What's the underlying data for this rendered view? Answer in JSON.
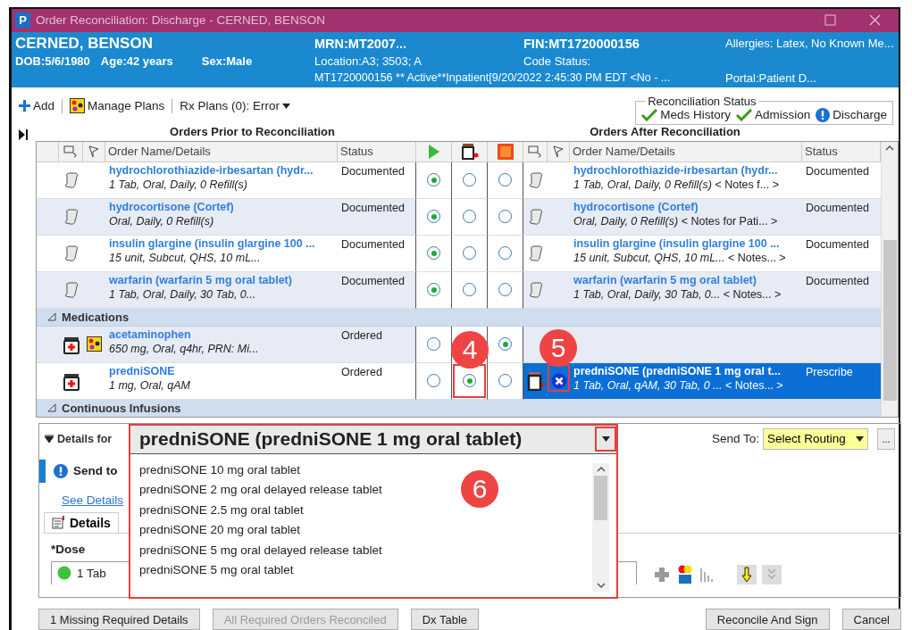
{
  "window": {
    "title": "Order Reconciliation: Discharge - CERNED, BENSON",
    "app_letter": "P"
  },
  "patient": {
    "name": "CERNED, BENSON",
    "dob": "DOB:5/6/1980",
    "age": "Age:42 years",
    "sex": "Sex:Male",
    "mrn": "MRN:MT2007...",
    "location": "Location:A3; 3503; A",
    "encounter": "MT1720000156 ** Active**Inpatient[9/20/2022 2:45:30 PM EDT <No - ...",
    "fin": "FIN:MT1720000156",
    "code_status": "Code Status:",
    "allergies": "Allergies: Latex, No Known Me...",
    "portal": "Portal:Patient D..."
  },
  "toolbar": [
    {
      "kind": "add",
      "label": "Add"
    },
    {
      "kind": "plans",
      "label": "Manage Plans"
    },
    {
      "kind": "menu",
      "label": "Rx Plans (0): Error"
    }
  ],
  "reconciliation_status": {
    "title": "Reconciliation Status",
    "items": [
      {
        "label": "Meds History",
        "complete": true
      },
      {
        "label": "Admission",
        "complete": true
      },
      {
        "label": "Discharge",
        "complete": false
      }
    ]
  },
  "prior": {
    "title": "Orders Prior to Reconciliation",
    "columns": [
      "Order Name/Details",
      "Status"
    ]
  },
  "after": {
    "title": "Orders After Reconciliation",
    "columns": [
      "Order Name/Details",
      "Status"
    ]
  },
  "rows": [
    {
      "kind": "order",
      "prior": {
        "kind": "home",
        "name": "hydrochlorothiazide-irbesartan (hydr...",
        "details": "1 Tab, Oral, Daily, 0 Refill(s)",
        "status": "Documented"
      },
      "choices": [
        {
          "kind": "continue",
          "selected": true
        },
        {
          "kind": "modify",
          "selected": false
        },
        {
          "kind": "stop",
          "selected": false
        }
      ],
      "after": {
        "kind": "home",
        "name": "hydrochlorothiazide-irbesartan (hydr...",
        "details": "*1 Tab, Oral, Daily, 0 Refill(s)* < Notes f... >",
        "status": "Documented",
        "selected": false
      }
    },
    {
      "kind": "order",
      "prior": {
        "kind": "home",
        "name": "hydrocortisone (Cortef)",
        "details": "Oral, Daily, 0 Refill(s)",
        "status": "Documented"
      },
      "choices": [
        {
          "kind": "continue",
          "selected": true
        },
        {
          "kind": "modify",
          "selected": false
        },
        {
          "kind": "stop",
          "selected": false
        }
      ],
      "after": {
        "kind": "home",
        "name": "hydrocortisone (Cortef)",
        "details": "*Oral, Daily, 0 Refill(s)* < Notes for Pati... >",
        "status": "Documented",
        "selected": false
      }
    },
    {
      "kind": "order",
      "prior": {
        "kind": "home",
        "name": "insulin glargine (insulin glargine 100 ...",
        "details": "15 unit, Subcut, QHS, 10 mL...",
        "status": "Documented"
      },
      "choices": [
        {
          "kind": "continue",
          "selected": true
        },
        {
          "kind": "modify",
          "selected": false
        },
        {
          "kind": "stop",
          "selected": false
        }
      ],
      "after": {
        "kind": "home",
        "name": "insulin glargine (insulin glargine 100 ...",
        "details": "*15 unit, Subcut, QHS, 10 mL...* < Notes... >",
        "status": "Documented",
        "selected": false
      }
    },
    {
      "kind": "order",
      "prior": {
        "kind": "home",
        "name": "warfarin (warfarin 5 mg oral tablet)",
        "details": "1 Tab, Oral, Daily, 30 Tab, 0...",
        "status": "Documented"
      },
      "choices": [
        {
          "kind": "continue",
          "selected": true
        },
        {
          "kind": "modify",
          "selected": false
        },
        {
          "kind": "stop",
          "selected": false
        }
      ],
      "after": {
        "kind": "home",
        "name": "warfarin (warfarin 5 mg oral tablet)",
        "details": "*1 Tab, Oral, Daily, 30 Tab, 0...* < Notes... >",
        "status": "Documented",
        "selected": false
      }
    },
    {
      "kind": "group",
      "label": "Medications",
      "expanded": true
    },
    {
      "kind": "order",
      "prior": {
        "kind": "inpatient",
        "in_plan": true,
        "name": "acetaminophen",
        "details": "650 mg, Oral, q4hr, PRN: Mi...",
        "status": "Ordered"
      },
      "choices": [
        {
          "kind": "continue",
          "selected": false
        },
        {
          "kind": "stop",
          "selected": true
        }
      ]
    },
    {
      "kind": "order",
      "prior": {
        "kind": "inpatient",
        "name": "predniSONE",
        "details": "1 mg, Oral, qAM",
        "status": "Ordered"
      },
      "choices": [
        {
          "kind": "continue",
          "selected": false
        },
        {
          "kind": "modify",
          "selected": true
        },
        {
          "kind": "stop",
          "selected": false
        }
      ],
      "after": {
        "kind": "prescription",
        "removable": true,
        "name": "predniSONE (predniSONE 1 mg oral t...",
        "details": "*1 Tab, Oral, qAM, 30 Tab, 0 ...* < Notes... >",
        "status": "Prescribe",
        "selected": true
      }
    },
    {
      "kind": "group",
      "label": "Continuous Infusions",
      "expanded": true
    }
  ],
  "details": {
    "label": "Details for",
    "order": "predniSONE (predniSONE 1 mg oral tablet)",
    "options": [
      "predniSONE 10 mg oral tablet",
      "predniSONE 2 mg oral delayed release tablet",
      "predniSONE 2.5 mg oral tablet",
      "predniSONE 20 mg oral tablet",
      "predniSONE 5 mg oral delayed release tablet",
      "predniSONE 5 mg oral tablet"
    ],
    "notice": "Send to",
    "see_details": "See Details",
    "tab": "Details",
    "dose_label": "*Dose",
    "dose": "1 Tab",
    "send_to_label": "Send To:",
    "routing": "Select Routing",
    "more": "..."
  },
  "buttons_left": [
    {
      "label": "1 Missing Required Details",
      "disabled": false
    },
    {
      "label": "All Required Orders Reconciled",
      "disabled": true
    },
    {
      "label": "Dx Table",
      "disabled": false
    }
  ],
  "buttons_right": [
    {
      "label": "Reconcile And Sign",
      "disabled": false
    },
    {
      "label": "Cancel",
      "disabled": false
    }
  ],
  "annotations": [
    {
      "kind": "choice",
      "label": "4"
    },
    {
      "kind": "remove",
      "label": "5"
    },
    {
      "kind": "dropdown",
      "label": "6"
    }
  ]
}
